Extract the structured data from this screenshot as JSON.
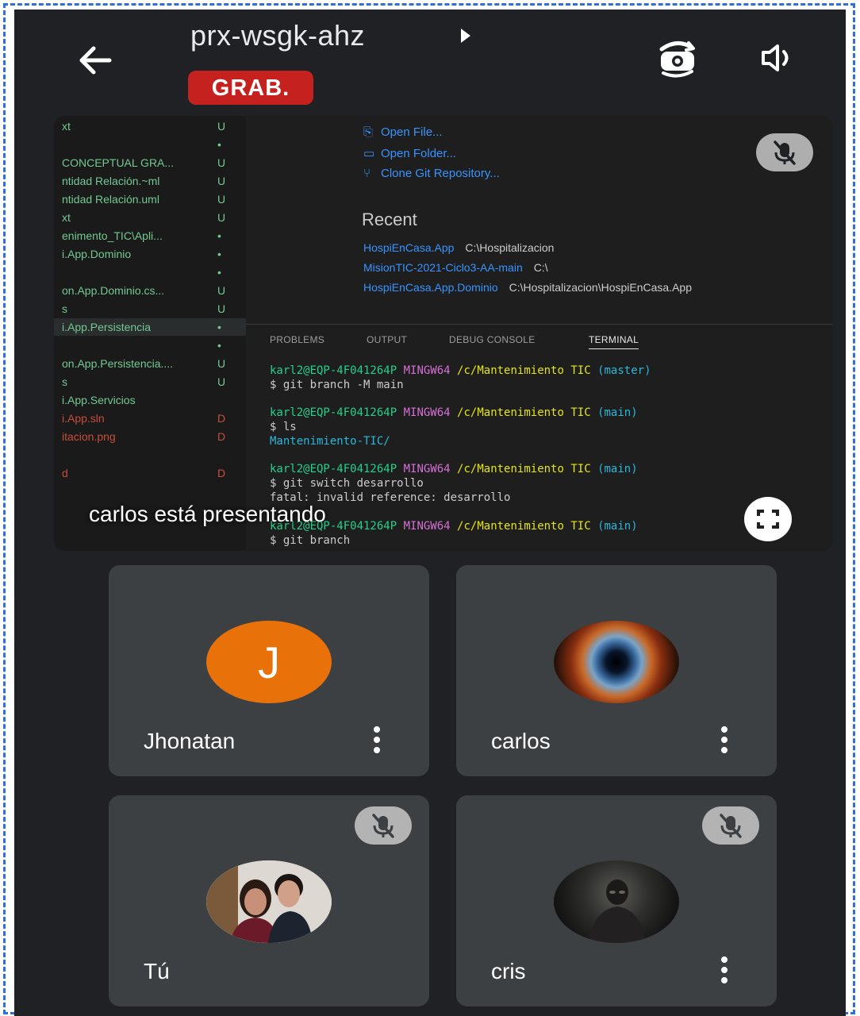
{
  "header": {
    "meeting_code": "prx-wsgk-ahz",
    "recording_badge": "GRAB."
  },
  "presentation": {
    "presenter_label": "carlos está presentando",
    "explorer": [
      {
        "name": "xt",
        "status": "U",
        "color": "green"
      },
      {
        "name": "",
        "status": "•",
        "color": "green"
      },
      {
        "name": "CONCEPTUAL GRA...",
        "status": "U",
        "color": "green"
      },
      {
        "name": "ntidad Relación.~ml",
        "status": "U",
        "color": "green"
      },
      {
        "name": "ntidad Relación.uml",
        "status": "U",
        "color": "green"
      },
      {
        "name": "xt",
        "status": "U",
        "color": "green"
      },
      {
        "name": "enimento_TIC\\Apli...",
        "status": "•",
        "color": "green"
      },
      {
        "name": "i.App.Dominio",
        "status": "•",
        "color": "green"
      },
      {
        "name": "",
        "status": "•",
        "color": "green"
      },
      {
        "name": "on.App.Dominio.cs...",
        "status": "U",
        "color": "green"
      },
      {
        "name": "s",
        "status": "U",
        "color": "green"
      },
      {
        "name": "i.App.Persistencia",
        "status": "•",
        "color": "green",
        "selected": true
      },
      {
        "name": "",
        "status": "•",
        "color": "green"
      },
      {
        "name": "on.App.Persistencia....",
        "status": "U",
        "color": "green"
      },
      {
        "name": "s",
        "status": "U",
        "color": "green"
      },
      {
        "name": "i.App.Servicios",
        "status": "",
        "color": "green"
      },
      {
        "name": "i.App.sln",
        "status": "D",
        "color": "red"
      },
      {
        "name": "itacion.png",
        "status": "D",
        "color": "red"
      },
      {
        "name": "",
        "status": "",
        "color": "red"
      },
      {
        "name": "d",
        "status": "D",
        "color": "red"
      }
    ],
    "start_links": [
      {
        "icon": "file-icon",
        "label": "Open File..."
      },
      {
        "icon": "folder-icon",
        "label": "Open Folder..."
      },
      {
        "icon": "git-icon",
        "label": "Clone Git Repository..."
      }
    ],
    "recent_heading": "Recent",
    "recent": [
      {
        "name": "HospiEnCasa.App",
        "path": "C:\\Hospitalizacion"
      },
      {
        "name": "MisionTIC-2021-Ciclo3-AA-main",
        "path": "C:\\"
      },
      {
        "name": "HospiEnCasa.App.Dominio",
        "path": "C:\\Hospitalizacion\\HospiEnCasa.App"
      }
    ],
    "panel_tabs": [
      "PROBLEMS",
      "OUTPUT",
      "DEBUG CONSOLE",
      "TERMINAL"
    ],
    "terminal": {
      "user": "karl2@EQP-4F041264P",
      "shell": "MINGW64",
      "path": "/c/Mantenimiento TIC",
      "branch_master": "(master)",
      "branch_main": "(main)",
      "cmd1": "$ git branch -M  main",
      "cmd2": "$ ls",
      "out2": "Mantenimiento-TIC/",
      "cmd3": "$ git switch desarrollo",
      "out3": "fatal: invalid reference: desarrollo",
      "cmd4": "$ git branch"
    }
  },
  "participants": [
    {
      "name": "Jhonatan",
      "avatar_letter": "J",
      "avatar_color": "#e8710a",
      "muted": false
    },
    {
      "name": "carlos",
      "avatar": "nebula-photo",
      "muted": false
    },
    {
      "name": "Tú",
      "avatar": "family-photo",
      "muted": true
    },
    {
      "name": "cris",
      "avatar": "dark-figure-photo",
      "muted": true
    }
  ],
  "colors": {
    "background": "#202124",
    "tile": "#3c4043",
    "recording": "#c5221f",
    "frame_border": "#2f6fd6"
  }
}
